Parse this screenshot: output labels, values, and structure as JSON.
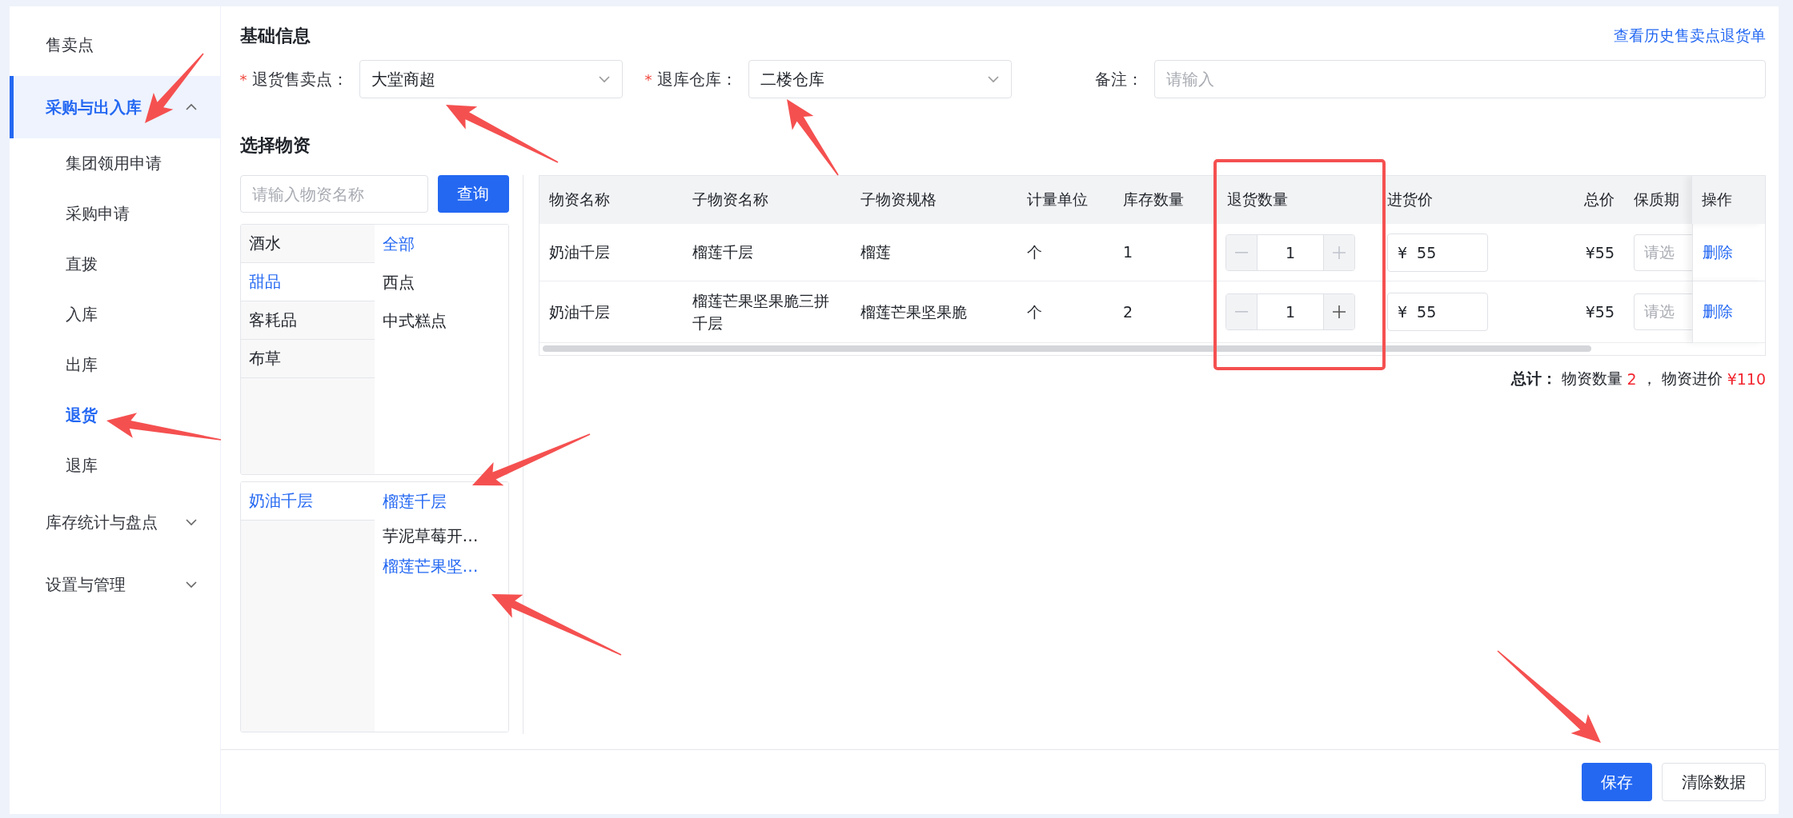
{
  "sidebar": {
    "items": [
      {
        "label": "售卖点",
        "selected": false
      },
      {
        "label": "采购与出入库",
        "selected": true,
        "expanded": true,
        "children": [
          {
            "label": "集团领用申请",
            "selected": false
          },
          {
            "label": "采购申请",
            "selected": false
          },
          {
            "label": "直拨",
            "selected": false
          },
          {
            "label": "入库",
            "selected": false
          },
          {
            "label": "出库",
            "selected": false
          },
          {
            "label": "退货",
            "selected": true
          },
          {
            "label": "退库",
            "selected": false
          }
        ]
      },
      {
        "label": "库存统计与盘点",
        "selected": false,
        "expanded": false
      },
      {
        "label": "设置与管理",
        "selected": false,
        "expanded": false
      }
    ]
  },
  "basic_info": {
    "title": "基础信息",
    "history_link": "查看历史售卖点退货单",
    "fields": [
      {
        "kind": "select",
        "mark": "*",
        "label": "退货售卖点：",
        "value": "大堂商超"
      },
      {
        "kind": "select",
        "mark": "*",
        "label": "退库仓库：",
        "value": "二楼仓库"
      },
      {
        "kind": "input",
        "label": "备注：",
        "placeholder": "请输入"
      }
    ]
  },
  "materials": {
    "title": "选择物资",
    "search": {
      "placeholder": "请输入物资名称",
      "button": "查询"
    },
    "categories": [
      {
        "label": "酒水",
        "selected": false
      },
      {
        "label": "甜品",
        "selected": true
      },
      {
        "label": "客耗品",
        "selected": false
      },
      {
        "label": "布草",
        "selected": false
      }
    ],
    "subcategories": [
      {
        "label": "全部",
        "selected": true
      },
      {
        "label": "西点",
        "selected": false
      },
      {
        "label": "中式糕点",
        "selected": false
      }
    ],
    "products": [
      {
        "label": "奶油千层",
        "selected": true
      }
    ],
    "variants": [
      {
        "label": "榴莲千层",
        "selected": true
      },
      {
        "label": "芋泥草莓开…",
        "selected": false
      },
      {
        "label": "榴莲芒果坚…",
        "selected": true
      }
    ]
  },
  "table": {
    "columns": [
      "物资名称",
      "子物资名称",
      "子物资规格",
      "计量单位",
      "库存数量",
      "退货数量",
      "进货价",
      "总价",
      "保质期",
      "操作"
    ],
    "rows": [
      {
        "name": "奶油千层",
        "sub_name": "榴莲千层",
        "spec": "榴莲",
        "unit": "个",
        "stock": "1",
        "minus_disabled": true,
        "quantity": "1",
        "plus_disabled": true,
        "currency": "¥",
        "price": "55",
        "total": "¥55",
        "expiry_placeholder": "请选",
        "action": "删除"
      },
      {
        "name": "奶油千层",
        "sub_name": "榴莲芒果坚果脆三拼千层",
        "spec": "榴莲芒果坚果脆",
        "unit": "个",
        "stock": "2",
        "minus_disabled": true,
        "quantity": "1",
        "plus_disabled": false,
        "currency": "¥",
        "price": "55",
        "total": "¥55",
        "expiry_placeholder": "请选",
        "action": "删除"
      }
    ]
  },
  "summary": {
    "title": "总计：",
    "separator": "，",
    "parts": [
      {
        "label": "物资数量",
        "value": "2"
      },
      {
        "label": "物资进价",
        "value": "¥110"
      }
    ]
  },
  "footer": {
    "buttons": [
      {
        "label": "保存",
        "kind": "primary"
      },
      {
        "label": "清除数据",
        "kind": "default"
      }
    ]
  }
}
